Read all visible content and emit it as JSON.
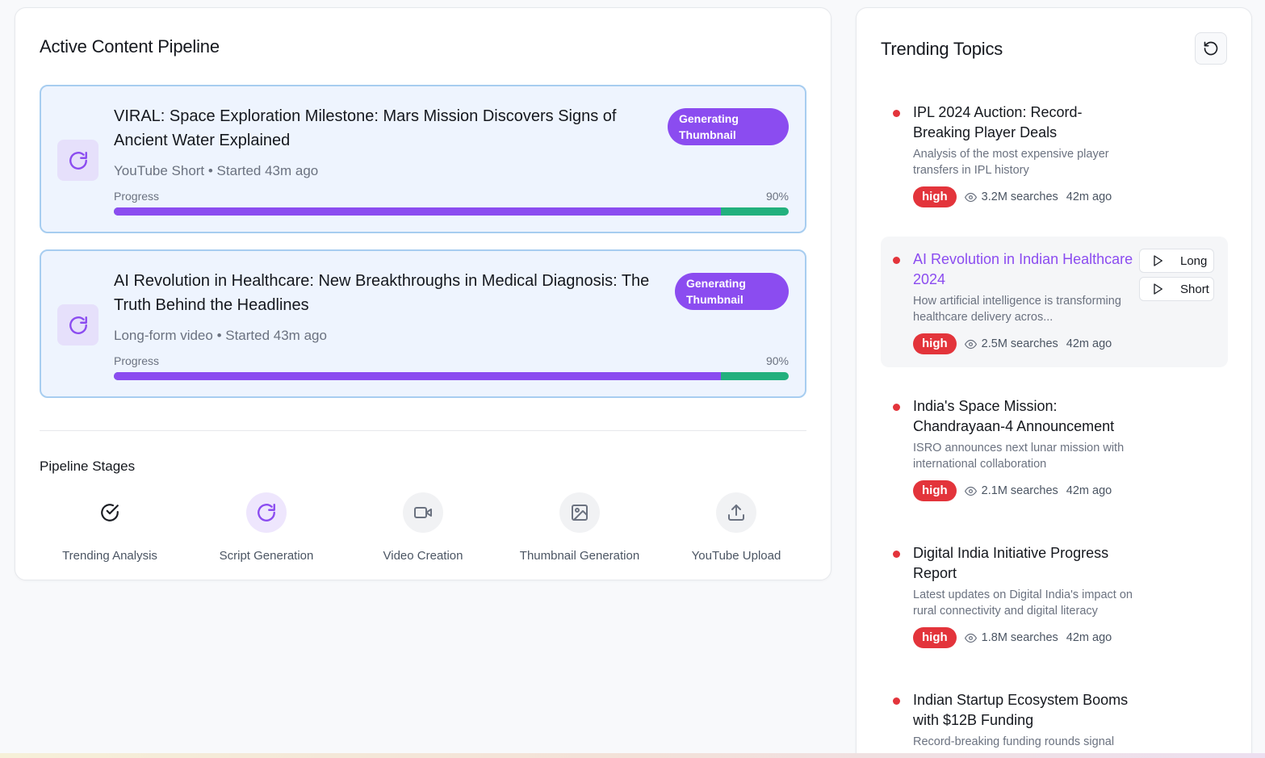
{
  "pipeline": {
    "title": "Active Content Pipeline",
    "jobs": [
      {
        "title": "VIRAL: Space Exploration Milestone: Mars Mission Discovers Signs of Ancient Water Explained",
        "meta": "YouTube Short • Started 43m ago",
        "status": "Generating Thumbnail",
        "progress_label": "Progress",
        "progress_pct": "90%",
        "progress_value": 0.9
      },
      {
        "title": "AI Revolution in Healthcare: New Breakthroughs in Medical Diagnosis: The Truth Behind the Headlines",
        "meta": "Long-form video • Started 43m ago",
        "status": "Generating Thumbnail",
        "progress_label": "Progress",
        "progress_pct": "90%",
        "progress_value": 0.9
      }
    ],
    "stages_title": "Pipeline Stages",
    "stages": [
      {
        "label": "Trending Analysis",
        "icon": "check-circle-icon",
        "state": "done"
      },
      {
        "label": "Script Generation",
        "icon": "refresh-icon",
        "state": "active"
      },
      {
        "label": "Video Creation",
        "icon": "video-camera-icon",
        "state": "pending"
      },
      {
        "label": "Thumbnail Generation",
        "icon": "image-icon",
        "state": "pending"
      },
      {
        "label": "YouTube Upload",
        "icon": "upload-icon",
        "state": "pending"
      }
    ]
  },
  "trending": {
    "title": "Trending Topics",
    "topics": [
      {
        "title": "IPL 2024 Auction: Record-Breaking Player Deals",
        "description": "Analysis of the most expensive player transfers in IPL history",
        "priority": "high",
        "searches": "3.2M searches",
        "time": "42m ago"
      },
      {
        "title": "AI Revolution in Indian Healthcare 2024",
        "description": "How artificial intelligence is transforming healthcare delivery acros...",
        "priority": "high",
        "searches": "2.5M searches",
        "time": "42m ago",
        "actions": [
          "Long",
          "Short"
        ]
      },
      {
        "title": "India's Space Mission: Chandrayaan-4 Announcement",
        "description": "ISRO announces next lunar mission with international collaboration",
        "priority": "high",
        "searches": "2.1M searches",
        "time": "42m ago"
      },
      {
        "title": "Digital India Initiative Progress Report",
        "description": "Latest updates on Digital India's impact on rural connectivity and digital literacy",
        "priority": "high",
        "searches": "1.8M searches",
        "time": "42m ago"
      },
      {
        "title": "Indian Startup Ecosystem Booms with $12B Funding",
        "description": "Record-breaking funding rounds signal"
      }
    ]
  },
  "colors": {
    "accent": "#8b4cf0",
    "progress_remainder": "#22b07d",
    "high": "#e3343b",
    "job_bg": "#eef4fe",
    "job_border": "#a7cdf0"
  }
}
